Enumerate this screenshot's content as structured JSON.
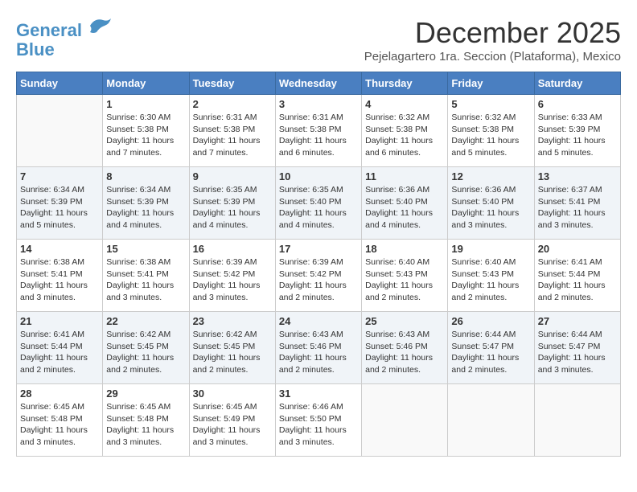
{
  "header": {
    "logo_line1": "General",
    "logo_line2": "Blue",
    "title": "December 2025",
    "subtitle": "Pejelagartero 1ra. Seccion (Plataforma), Mexico"
  },
  "weekdays": [
    "Sunday",
    "Monday",
    "Tuesday",
    "Wednesday",
    "Thursday",
    "Friday",
    "Saturday"
  ],
  "weeks": [
    [
      {
        "day": "",
        "info": ""
      },
      {
        "day": "1",
        "info": "Sunrise: 6:30 AM\nSunset: 5:38 PM\nDaylight: 11 hours\nand 7 minutes."
      },
      {
        "day": "2",
        "info": "Sunrise: 6:31 AM\nSunset: 5:38 PM\nDaylight: 11 hours\nand 7 minutes."
      },
      {
        "day": "3",
        "info": "Sunrise: 6:31 AM\nSunset: 5:38 PM\nDaylight: 11 hours\nand 6 minutes."
      },
      {
        "day": "4",
        "info": "Sunrise: 6:32 AM\nSunset: 5:38 PM\nDaylight: 11 hours\nand 6 minutes."
      },
      {
        "day": "5",
        "info": "Sunrise: 6:32 AM\nSunset: 5:38 PM\nDaylight: 11 hours\nand 5 minutes."
      },
      {
        "day": "6",
        "info": "Sunrise: 6:33 AM\nSunset: 5:39 PM\nDaylight: 11 hours\nand 5 minutes."
      }
    ],
    [
      {
        "day": "7",
        "info": "Sunrise: 6:34 AM\nSunset: 5:39 PM\nDaylight: 11 hours\nand 5 minutes."
      },
      {
        "day": "8",
        "info": "Sunrise: 6:34 AM\nSunset: 5:39 PM\nDaylight: 11 hours\nand 4 minutes."
      },
      {
        "day": "9",
        "info": "Sunrise: 6:35 AM\nSunset: 5:39 PM\nDaylight: 11 hours\nand 4 minutes."
      },
      {
        "day": "10",
        "info": "Sunrise: 6:35 AM\nSunset: 5:40 PM\nDaylight: 11 hours\nand 4 minutes."
      },
      {
        "day": "11",
        "info": "Sunrise: 6:36 AM\nSunset: 5:40 PM\nDaylight: 11 hours\nand 4 minutes."
      },
      {
        "day": "12",
        "info": "Sunrise: 6:36 AM\nSunset: 5:40 PM\nDaylight: 11 hours\nand 3 minutes."
      },
      {
        "day": "13",
        "info": "Sunrise: 6:37 AM\nSunset: 5:41 PM\nDaylight: 11 hours\nand 3 minutes."
      }
    ],
    [
      {
        "day": "14",
        "info": "Sunrise: 6:38 AM\nSunset: 5:41 PM\nDaylight: 11 hours\nand 3 minutes."
      },
      {
        "day": "15",
        "info": "Sunrise: 6:38 AM\nSunset: 5:41 PM\nDaylight: 11 hours\nand 3 minutes."
      },
      {
        "day": "16",
        "info": "Sunrise: 6:39 AM\nSunset: 5:42 PM\nDaylight: 11 hours\nand 3 minutes."
      },
      {
        "day": "17",
        "info": "Sunrise: 6:39 AM\nSunset: 5:42 PM\nDaylight: 11 hours\nand 2 minutes."
      },
      {
        "day": "18",
        "info": "Sunrise: 6:40 AM\nSunset: 5:43 PM\nDaylight: 11 hours\nand 2 minutes."
      },
      {
        "day": "19",
        "info": "Sunrise: 6:40 AM\nSunset: 5:43 PM\nDaylight: 11 hours\nand 2 minutes."
      },
      {
        "day": "20",
        "info": "Sunrise: 6:41 AM\nSunset: 5:44 PM\nDaylight: 11 hours\nand 2 minutes."
      }
    ],
    [
      {
        "day": "21",
        "info": "Sunrise: 6:41 AM\nSunset: 5:44 PM\nDaylight: 11 hours\nand 2 minutes."
      },
      {
        "day": "22",
        "info": "Sunrise: 6:42 AM\nSunset: 5:45 PM\nDaylight: 11 hours\nand 2 minutes."
      },
      {
        "day": "23",
        "info": "Sunrise: 6:42 AM\nSunset: 5:45 PM\nDaylight: 11 hours\nand 2 minutes."
      },
      {
        "day": "24",
        "info": "Sunrise: 6:43 AM\nSunset: 5:46 PM\nDaylight: 11 hours\nand 2 minutes."
      },
      {
        "day": "25",
        "info": "Sunrise: 6:43 AM\nSunset: 5:46 PM\nDaylight: 11 hours\nand 2 minutes."
      },
      {
        "day": "26",
        "info": "Sunrise: 6:44 AM\nSunset: 5:47 PM\nDaylight: 11 hours\nand 2 minutes."
      },
      {
        "day": "27",
        "info": "Sunrise: 6:44 AM\nSunset: 5:47 PM\nDaylight: 11 hours\nand 3 minutes."
      }
    ],
    [
      {
        "day": "28",
        "info": "Sunrise: 6:45 AM\nSunset: 5:48 PM\nDaylight: 11 hours\nand 3 minutes."
      },
      {
        "day": "29",
        "info": "Sunrise: 6:45 AM\nSunset: 5:48 PM\nDaylight: 11 hours\nand 3 minutes."
      },
      {
        "day": "30",
        "info": "Sunrise: 6:45 AM\nSunset: 5:49 PM\nDaylight: 11 hours\nand 3 minutes."
      },
      {
        "day": "31",
        "info": "Sunrise: 6:46 AM\nSunset: 5:50 PM\nDaylight: 11 hours\nand 3 minutes."
      },
      {
        "day": "",
        "info": ""
      },
      {
        "day": "",
        "info": ""
      },
      {
        "day": "",
        "info": ""
      }
    ]
  ]
}
